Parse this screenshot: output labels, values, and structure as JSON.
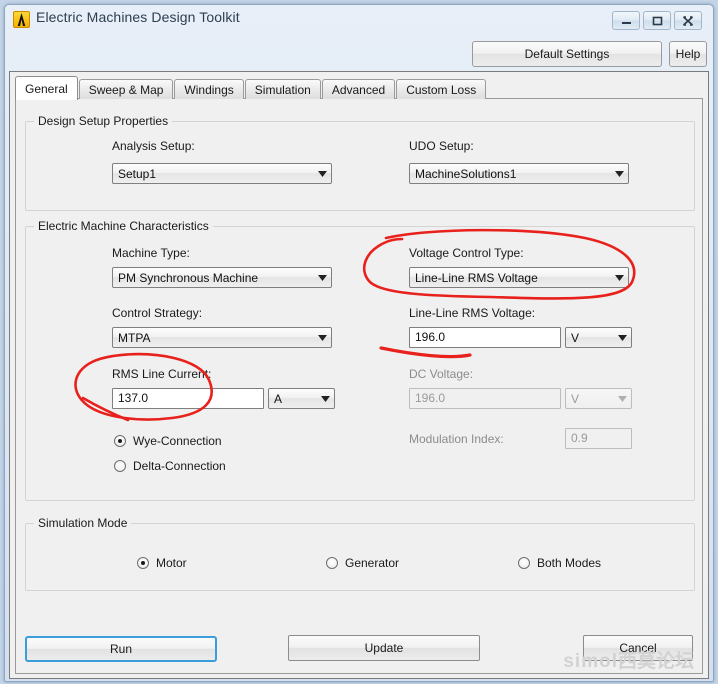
{
  "window": {
    "title": "Electric Machines Design Toolkit",
    "icon": "ansys-lambda-icon",
    "buttons": {
      "minimize": "minimize-icon",
      "maximize": "maximize-icon",
      "close": "close-icon"
    }
  },
  "toolbar": {
    "default_settings_label": "Default Settings",
    "help_label": "Help"
  },
  "tabs": [
    {
      "label": "General",
      "active": true
    },
    {
      "label": "Sweep & Map",
      "active": false
    },
    {
      "label": "Windings",
      "active": false
    },
    {
      "label": "Simulation",
      "active": false
    },
    {
      "label": "Advanced",
      "active": false
    },
    {
      "label": "Custom Loss",
      "active": false
    }
  ],
  "design_setup": {
    "group_label": "Design Setup Properties",
    "analysis_setup": {
      "label": "Analysis Setup:",
      "value": "Setup1"
    },
    "udo_setup": {
      "label": "UDO Setup:",
      "value": "MachineSolutions1"
    }
  },
  "machine_characteristics": {
    "group_label": "Electric Machine Characteristics",
    "machine_type": {
      "label": "Machine Type:",
      "value": "PM Synchronous Machine"
    },
    "control_strategy": {
      "label": "Control Strategy:",
      "value": "MTPA"
    },
    "rms_line_current": {
      "label": "RMS Line Current:",
      "value": "137.0",
      "unit": "A"
    },
    "connection": {
      "options": [
        {
          "label": "Wye-Connection",
          "selected": true
        },
        {
          "label": "Delta-Connection",
          "selected": false
        }
      ]
    },
    "voltage_control_type": {
      "label": "Voltage Control Type:",
      "value": "Line-Line RMS Voltage"
    },
    "line_line_rms_voltage": {
      "label": "Line-Line RMS Voltage:",
      "value": "196.0",
      "unit": "V"
    },
    "dc_voltage": {
      "label": "DC Voltage:",
      "value": "196.0",
      "unit": "V",
      "disabled": true
    },
    "modulation_index": {
      "label": "Modulation Index:",
      "value": "0.9",
      "disabled": true
    }
  },
  "simulation_mode": {
    "group_label": "Simulation Mode",
    "options": [
      {
        "label": "Motor",
        "selected": true
      },
      {
        "label": "Generator",
        "selected": false
      },
      {
        "label": "Both Modes",
        "selected": false
      }
    ]
  },
  "footer": {
    "run_label": "Run",
    "update_label": "Update",
    "cancel_label": "Cancel"
  },
  "watermark": {
    "latin": "simol",
    "chinese": "西莫论坛"
  },
  "annotation": {
    "color": "#e8211c",
    "marks": [
      "ellipse-around-voltage-control-type",
      "ellipse-around-rms-line-current",
      "underline-below-line-line-rms-voltage"
    ]
  }
}
